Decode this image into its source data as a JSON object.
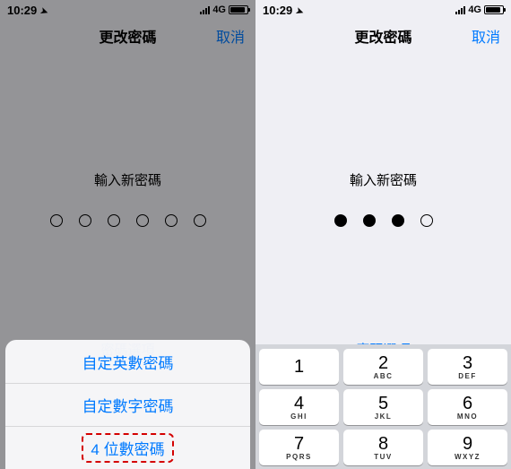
{
  "status": {
    "time": "10:29",
    "network": "4G"
  },
  "nav": {
    "title": "更改密碼",
    "cancel": "取消"
  },
  "body": {
    "prompt": "輸入新密碼",
    "options": "密碼選項"
  },
  "sheet": {
    "items": [
      "自定英數密碼",
      "自定數字密碼",
      "4 位數密碼"
    ]
  },
  "keypad": [
    {
      "n": "1",
      "l": ""
    },
    {
      "n": "2",
      "l": "ABC"
    },
    {
      "n": "3",
      "l": "DEF"
    },
    {
      "n": "4",
      "l": "GHI"
    },
    {
      "n": "5",
      "l": "JKL"
    },
    {
      "n": "6",
      "l": "MNO"
    },
    {
      "n": "7",
      "l": "PQRS"
    },
    {
      "n": "8",
      "l": "TUV"
    },
    {
      "n": "9",
      "l": "WXYZ"
    }
  ],
  "right_dots_filled": 3,
  "right_dots_total": 4,
  "left_dots_total": 6
}
